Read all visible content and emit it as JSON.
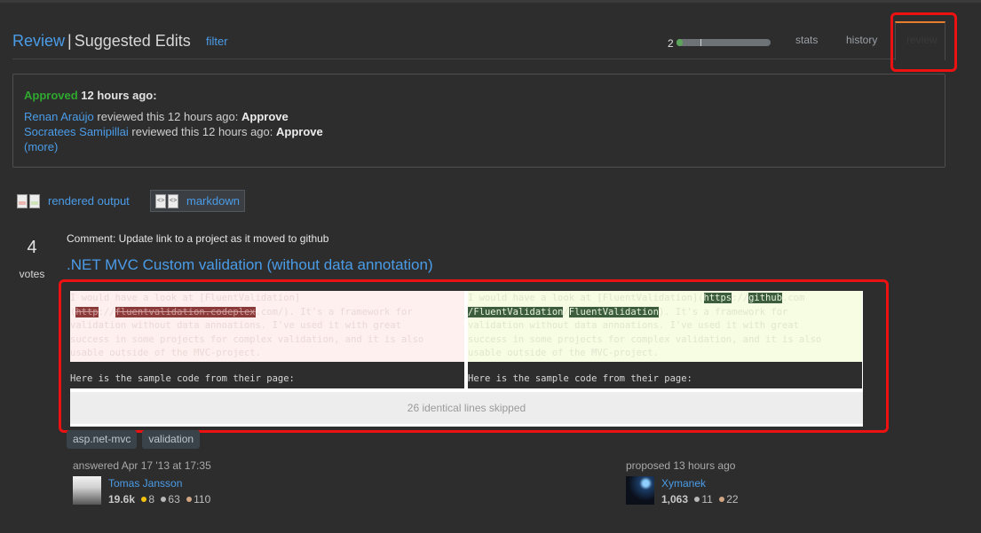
{
  "header": {
    "review_link": "Review",
    "separator": "|",
    "page_title": "Suggested Edits",
    "filter_label": "filter",
    "progress_count": "2",
    "progress_fraction": 0.07,
    "tabs": [
      {
        "label": "stats"
      },
      {
        "label": "history"
      },
      {
        "label": "review",
        "active": true
      }
    ]
  },
  "status": {
    "result": "Approved",
    "when": "12 hours ago:",
    "reviews": [
      {
        "user": "Renan Araújo",
        "text": " reviewed this 12 hours ago: ",
        "verdict": "Approve"
      },
      {
        "user": "Socratees Samipillai",
        "text": " reviewed this 12 hours ago: ",
        "verdict": "Approve"
      }
    ],
    "more_label": "(more)"
  },
  "view_toggle": {
    "rendered_label": "rendered output",
    "markdown_label": "markdown",
    "selected": "markdown"
  },
  "post": {
    "votes": "4",
    "votes_label": "votes",
    "comment": "Comment: Update link to a project as it moved to github",
    "title": ".NET MVC Custom validation (without data annotation)",
    "diff": {
      "left": {
        "l1": "I would have a look at [FluentValidation]",
        "l2_pre": "(",
        "l2_del1": "http",
        "l2_mid": "://",
        "l2_del2": "fluentvalidation.codeplex",
        "l2_post": ".com/). It's a framework for",
        "l3": "validation without data annoations. I've used it with great",
        "l4": "success in some projects for complex validation, and it is also",
        "l5": "usable outside of the MVC-project."
      },
      "right": {
        "l1_pre": "I would have a look at [FluentValidation](",
        "l1_ins1": "https",
        "l1_mid": "://",
        "l1_ins2": "github",
        "l1_post": ".com",
        "l2_ins1": "/FluentValidation",
        "l2_mid": "/",
        "l2_ins2": "FluentValidation",
        "l2_post": "). It's a framework for",
        "l3": "validation without data annoations. I've used it with great",
        "l4": "success in some projects for complex validation, and it is also",
        "l5": "usable outside of the MVC-project."
      },
      "same_line": "Here is the sample code from their page:",
      "skipped": "26 identical lines skipped"
    },
    "tags": [
      "asp.net-mvc",
      "validation"
    ]
  },
  "answerer": {
    "action": "answered Apr 17 '13 at 17:35",
    "name": "Tomas Jansson",
    "rep": "19.6k",
    "gold": "8",
    "silver": "63",
    "bronze": "110"
  },
  "proposer": {
    "action": "proposed 13 hours ago",
    "name": "Xymanek",
    "rep": "1,063",
    "silver": "11",
    "bronze": "22"
  },
  "colors": {
    "link": "#4a9ce8",
    "approved": "#2fa82f",
    "active_tab": "#e87d2e",
    "highlight": "#ee1111"
  }
}
